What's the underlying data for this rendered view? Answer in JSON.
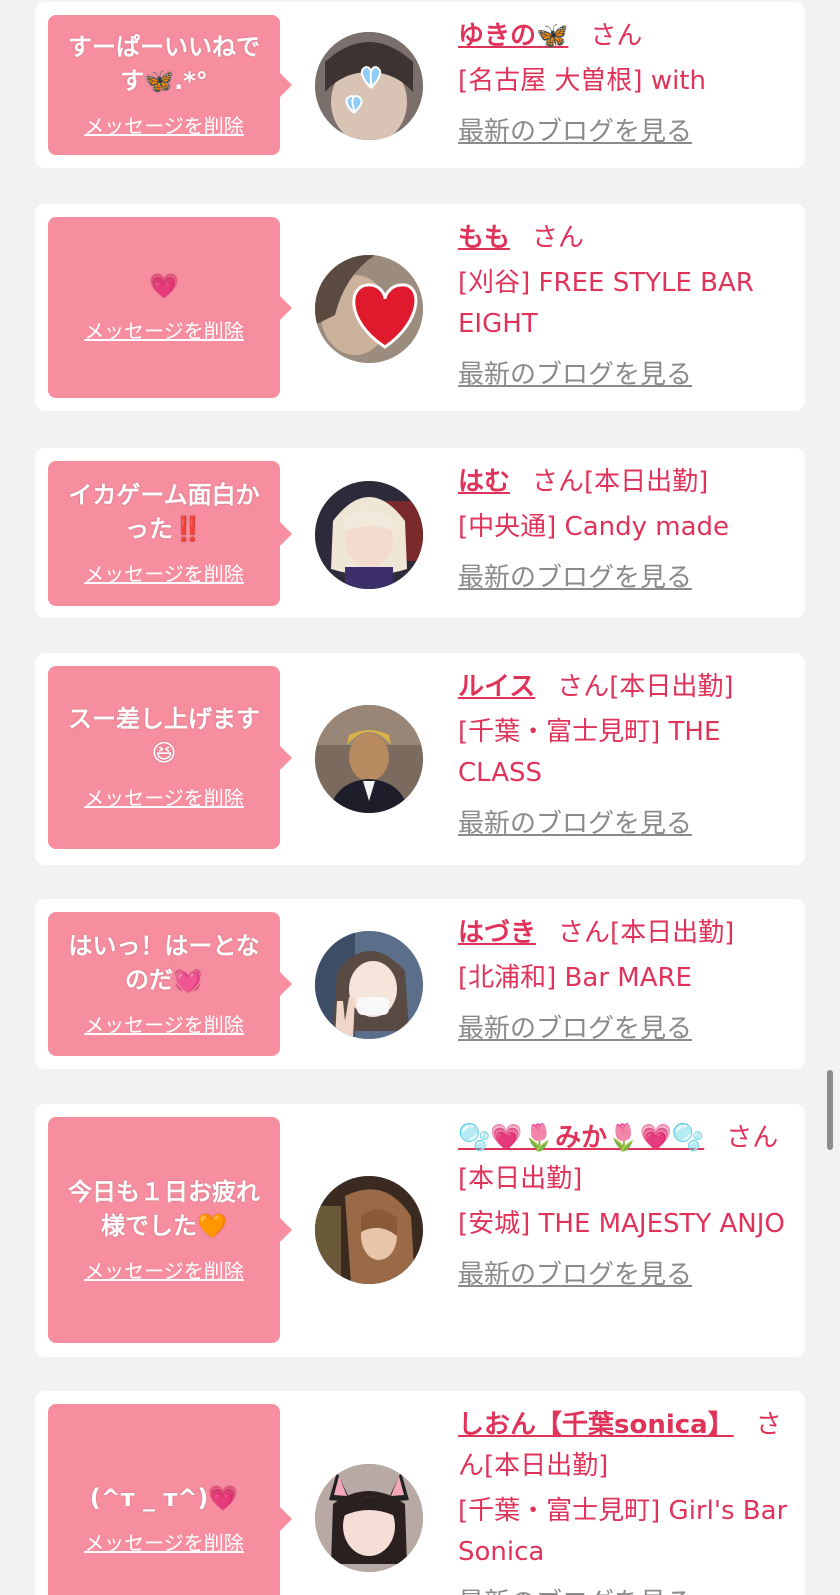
{
  "colors": {
    "bubble_bg": "#f68ea0",
    "text_pink": "#e0335a",
    "blog_link_gray": "#8a8a8a",
    "page_bg": "#f2f2f2"
  },
  "delete_label": "メッセージを削除",
  "blog_label": "最新のブログを見る",
  "san_label": "さん",
  "messages": [
    {
      "message": "すーぱーいいねです🦋.*°",
      "name": "ゆきの🦋",
      "status": "",
      "shop": "[名古屋 大曽根] with",
      "avatar": "butterfly-sticker-photo"
    },
    {
      "message": "💗",
      "name": "もも",
      "status": "",
      "shop": "[刈谷] FREE STYLE BAR EIGHT",
      "avatar": "heart-sticker-photo"
    },
    {
      "message": "イカゲーム面白かった‼️",
      "name": "はむ",
      "status": "[本日出勤]",
      "shop": "[中央通] Candy made",
      "avatar": "blonde-girl-photo"
    },
    {
      "message": "スー差し上げます😆",
      "name": "ルイス",
      "status": "[本日出勤]",
      "shop": "[千葉・富士見町] THE CLASS",
      "avatar": "man-in-suit-photo"
    },
    {
      "message": "はいっ！はーとなのだ💓",
      "name": "はづき",
      "status": "[本日出勤]",
      "shop": "[北浦和] Bar MARE",
      "avatar": "peace-sign-girl-photo"
    },
    {
      "message": "今日も１日お疲れ様でした🧡",
      "name": "🫧💗🌷みか🌷💗🫧",
      "status": "[本日出勤]",
      "shop": "[安城] THE MAJESTY ANJO",
      "avatar": "brown-hair-girl-photo"
    },
    {
      "message": "(^т _ т^)💗",
      "name": "しおん【千葉sonica】",
      "status": "[本日出勤]",
      "shop": "[千葉・富士見町] Girl's Bar Sonica",
      "avatar": "cat-ears-girl-photo"
    }
  ]
}
